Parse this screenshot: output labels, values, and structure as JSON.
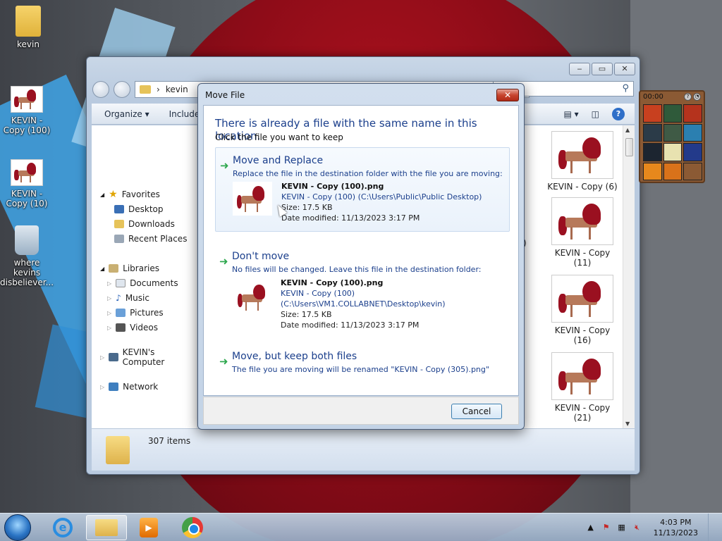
{
  "desktop": {
    "icons": [
      {
        "label": "kevin"
      },
      {
        "label": "KEVIN - Copy (100)"
      },
      {
        "label": "KEVIN - Copy (10)"
      },
      {
        "label": "where kevins disbeliever..."
      }
    ]
  },
  "explorer": {
    "address_folder": "kevin",
    "toolbar": {
      "organize": "Organize ▾",
      "include": "Include"
    },
    "nav": {
      "favorites": "Favorites",
      "desktop": "Desktop",
      "downloads": "Downloads",
      "recent": "Recent Places",
      "libraries": "Libraries",
      "documents": "Documents",
      "music": "Music",
      "pictures": "Pictures",
      "videos": "Videos",
      "computer": "KEVIN's Computer",
      "network": "Network"
    },
    "tiles": [
      {
        "label": "KEVIN - Copy (6)"
      },
      {
        "label": "KEVIN - Copy (11)"
      },
      {
        "label": "KEVIN - Copy (16)"
      },
      {
        "label": "KEVIN - Copy (21)"
      }
    ],
    "partial_label": ")",
    "status": "307 items"
  },
  "gadget": {
    "time": "00:00"
  },
  "dialog": {
    "title": "Move File",
    "heading": "There is already a file with the same name in this location.",
    "subheading": "Click the file you want to keep",
    "replace": {
      "title": "Move and Replace",
      "desc": "Replace the file in the destination folder with the file you are moving:",
      "file_name": "KEVIN - Copy (100).png",
      "file_path": "KEVIN - Copy (100) (C:\\Users\\Public\\Public Desktop)",
      "size": "Size: 17.5 KB",
      "modified": "Date modified: 11/13/2023 3:17 PM"
    },
    "dont_move": {
      "title": "Don't move",
      "desc": "No files will be changed. Leave this file in the destination folder:",
      "file_name": "KEVIN - Copy (100).png",
      "file_path_1": "KEVIN - Copy (100)",
      "file_path_2": "(C:\\Users\\VM1.COLLABNET\\Desktop\\kevin)",
      "size": "Size: 17.5 KB",
      "modified": "Date modified: 11/13/2023 3:17 PM"
    },
    "keep_both": {
      "title": "Move, but keep both files",
      "desc": "The file you are moving will be renamed \"KEVIN - Copy (305).png\""
    },
    "cancel": "Cancel"
  },
  "taskbar": {
    "time": "4:03 PM",
    "date": "11/13/2023"
  }
}
